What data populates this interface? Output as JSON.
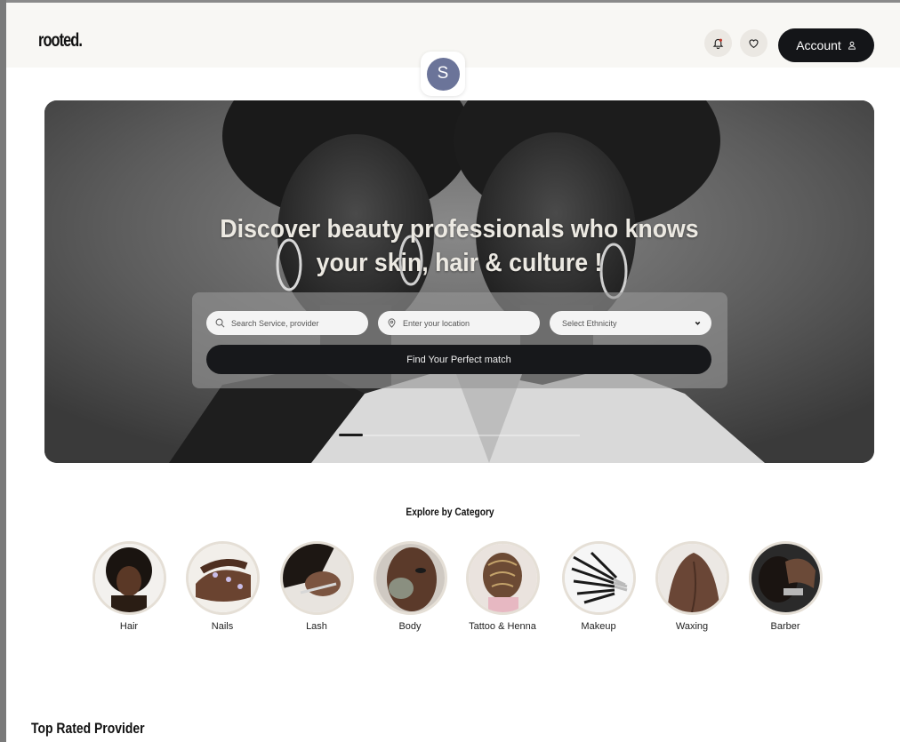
{
  "header": {
    "logo": "rooted.",
    "account_label": "Account",
    "avatar_initial": "S"
  },
  "hero": {
    "title": "Discover beauty professionals who knows your skin, hair & culture !",
    "search": {
      "service_placeholder": "Search Service, provider",
      "location_placeholder": "Enter your location",
      "ethnicity_selected": "Select Ethnicity",
      "find_button": "Find Your Perfect match"
    },
    "carousel_progress": 0.1
  },
  "categories": {
    "title": "Explore by Category",
    "items": [
      {
        "label": "Hair"
      },
      {
        "label": "Nails"
      },
      {
        "label": "Lash"
      },
      {
        "label": "Body"
      },
      {
        "label": "Tattoo & Henna"
      },
      {
        "label": "Makeup"
      },
      {
        "label": "Waxing"
      },
      {
        "label": "Barber"
      }
    ]
  },
  "top_rated": {
    "title": "Top Rated Provider"
  },
  "colors": {
    "header_bg": "#f8f7f4",
    "primary_dark": "#141518",
    "avatar": "#6b7499",
    "category_ring": "#e5dfd6"
  },
  "icons": [
    "bell-icon",
    "heart-icon",
    "user-icon",
    "search-icon",
    "location-pin-icon",
    "chevron-down-icon"
  ]
}
